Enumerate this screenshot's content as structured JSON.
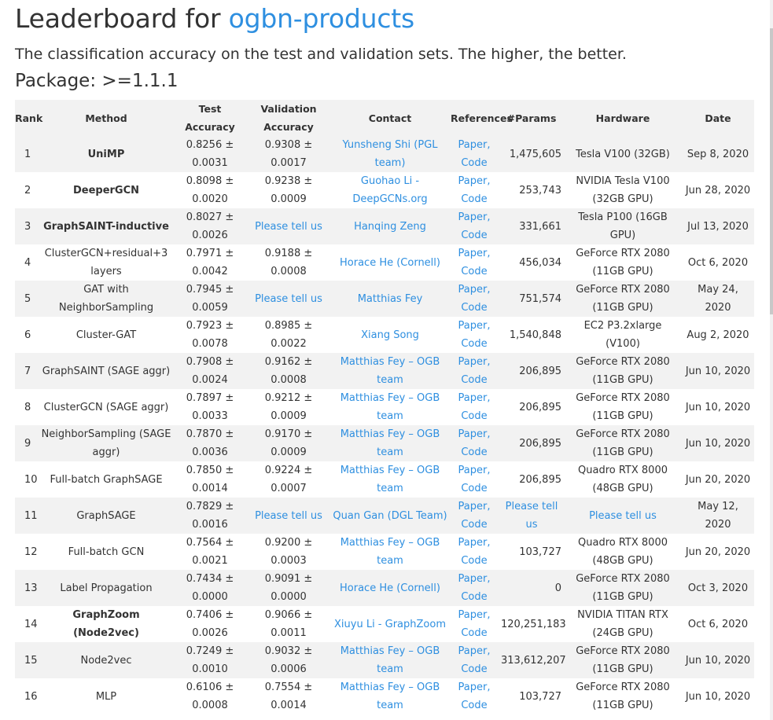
{
  "header": {
    "title_prefix": "Leaderboard for ",
    "title_link": "ogbn-products",
    "description": "The classification accuracy on the test and validation sets. The higher, the better.",
    "package": "Package: >=1.1.1"
  },
  "table": {
    "columns": [
      "Rank",
      "Method",
      "Test Accuracy",
      "Validation Accuracy",
      "Contact",
      "References",
      "#Params",
      "Hardware",
      "Date"
    ],
    "rows": [
      {
        "rank": "1",
        "method": "UniMP",
        "bold": true,
        "test": "0.8256 ± 0.0031",
        "val": "0.9308 ± 0.0017",
        "contact": "Yunsheng Shi (PGL team)",
        "contact_link": true,
        "refs": "Paper, Code",
        "params": "1,475,605",
        "params_link": false,
        "hardware": "Tesla V100 (32GB)",
        "hardware_link": false,
        "date": "Sep 8, 2020"
      },
      {
        "rank": "2",
        "method": "DeeperGCN",
        "bold": true,
        "test": "0.8098 ± 0.0020",
        "val": "0.9238 ± 0.0009",
        "contact": "Guohao Li - DeepGCNs.org",
        "contact_link": true,
        "refs": "Paper, Code",
        "params": "253,743",
        "params_link": false,
        "hardware": "NVIDIA Tesla V100 (32GB GPU)",
        "hardware_link": false,
        "date": "Jun 28, 2020"
      },
      {
        "rank": "3",
        "method": "GraphSAINT-inductive",
        "bold": true,
        "test": "0.8027 ± 0.0026",
        "val": "Please tell us",
        "val_link": true,
        "contact": "Hanqing Zeng",
        "contact_link": true,
        "refs": "Paper, Code",
        "params": "331,661",
        "params_link": false,
        "hardware": "Tesla P100 (16GB GPU)",
        "hardware_link": false,
        "date": "Jul 13, 2020"
      },
      {
        "rank": "4",
        "method": "ClusterGCN+residual+3 layers",
        "bold": false,
        "test": "0.7971 ± 0.0042",
        "val": "0.9188 ± 0.0008",
        "contact": "Horace He (Cornell)",
        "contact_link": true,
        "refs": "Paper, Code",
        "params": "456,034",
        "params_link": false,
        "hardware": "GeForce RTX 2080 (11GB GPU)",
        "hardware_link": false,
        "date": "Oct 6, 2020"
      },
      {
        "rank": "5",
        "method": "GAT with NeighborSampling",
        "bold": false,
        "test": "0.7945 ± 0.0059",
        "val": "Please tell us",
        "val_link": true,
        "contact": "Matthias Fey",
        "contact_link": true,
        "refs": "Paper, Code",
        "params": "751,574",
        "params_link": false,
        "hardware": "GeForce RTX 2080 (11GB GPU)",
        "hardware_link": false,
        "date": "May 24, 2020"
      },
      {
        "rank": "6",
        "method": "Cluster-GAT",
        "bold": false,
        "test": "0.7923 ± 0.0078",
        "val": "0.8985 ± 0.0022",
        "contact": "Xiang Song",
        "contact_link": true,
        "refs": "Paper, Code",
        "params": "1,540,848",
        "params_link": false,
        "hardware": "EC2 P3.2xlarge (V100)",
        "hardware_link": false,
        "date": "Aug 2, 2020"
      },
      {
        "rank": "7",
        "method": "GraphSAINT (SAGE aggr)",
        "bold": false,
        "test": "0.7908 ± 0.0024",
        "val": "0.9162 ± 0.0008",
        "contact": "Matthias Fey – OGB team",
        "contact_link": true,
        "refs": "Paper, Code",
        "params": "206,895",
        "params_link": false,
        "hardware": "GeForce RTX 2080 (11GB GPU)",
        "hardware_link": false,
        "date": "Jun 10, 2020"
      },
      {
        "rank": "8",
        "method": "ClusterGCN (SAGE aggr)",
        "bold": false,
        "test": "0.7897 ± 0.0033",
        "val": "0.9212 ± 0.0009",
        "contact": "Matthias Fey – OGB team",
        "contact_link": true,
        "refs": "Paper, Code",
        "params": "206,895",
        "params_link": false,
        "hardware": "GeForce RTX 2080 (11GB GPU)",
        "hardware_link": false,
        "date": "Jun 10, 2020"
      },
      {
        "rank": "9",
        "method": "NeighborSampling (SAGE aggr)",
        "bold": false,
        "test": "0.7870 ± 0.0036",
        "val": "0.9170 ± 0.0009",
        "contact": "Matthias Fey – OGB team",
        "contact_link": true,
        "refs": "Paper, Code",
        "params": "206,895",
        "params_link": false,
        "hardware": "GeForce RTX 2080 (11GB GPU)",
        "hardware_link": false,
        "date": "Jun 10, 2020"
      },
      {
        "rank": "10",
        "method": "Full-batch GraphSAGE",
        "bold": false,
        "test": "0.7850 ± 0.0014",
        "val": "0.9224 ± 0.0007",
        "contact": "Matthias Fey – OGB team",
        "contact_link": true,
        "refs": "Paper, Code",
        "params": "206,895",
        "params_link": false,
        "hardware": "Quadro RTX 8000 (48GB GPU)",
        "hardware_link": false,
        "date": "Jun 20, 2020"
      },
      {
        "rank": "11",
        "method": "GraphSAGE",
        "bold": false,
        "test": "0.7829 ± 0.0016",
        "val": "Please tell us",
        "val_link": true,
        "contact": "Quan Gan (DGL Team)",
        "contact_link": true,
        "refs": "Paper, Code",
        "params": "Please tell us",
        "params_link": true,
        "hardware": "Please tell us",
        "hardware_link": true,
        "date": "May 12, 2020"
      },
      {
        "rank": "12",
        "method": "Full-batch GCN",
        "bold": false,
        "test": "0.7564 ± 0.0021",
        "val": "0.9200 ± 0.0003",
        "contact": "Matthias Fey – OGB team",
        "contact_link": true,
        "refs": "Paper, Code",
        "params": "103,727",
        "params_link": false,
        "hardware": "Quadro RTX 8000 (48GB GPU)",
        "hardware_link": false,
        "date": "Jun 20, 2020"
      },
      {
        "rank": "13",
        "method": "Label Propagation",
        "bold": false,
        "test": "0.7434 ± 0.0000",
        "val": "0.9091 ± 0.0000",
        "contact": "Horace He (Cornell)",
        "contact_link": true,
        "refs": "Paper, Code",
        "params": "0",
        "params_link": false,
        "hardware": "GeForce RTX 2080 (11GB GPU)",
        "hardware_link": false,
        "date": "Oct 3, 2020"
      },
      {
        "rank": "14",
        "method": "GraphZoom (Node2vec)",
        "bold": true,
        "test": "0.7406 ± 0.0026",
        "val": "0.9066 ± 0.0011",
        "contact": "Xiuyu Li - GraphZoom",
        "contact_link": true,
        "refs": "Paper, Code",
        "params": "120,251,183",
        "params_link": false,
        "hardware": "NVIDIA TITAN RTX (24GB GPU)",
        "hardware_link": false,
        "date": "Oct 6, 2020"
      },
      {
        "rank": "15",
        "method": "Node2vec",
        "bold": false,
        "test": "0.7249 ± 0.0010",
        "val": "0.9032 ± 0.0006",
        "contact": "Matthias Fey – OGB team",
        "contact_link": true,
        "refs": "Paper, Code",
        "params": "313,612,207",
        "params_link": false,
        "hardware": "GeForce RTX 2080 (11GB GPU)",
        "hardware_link": false,
        "date": "Jun 10, 2020"
      },
      {
        "rank": "16",
        "method": "MLP",
        "bold": false,
        "test": "0.6106 ± 0.0008",
        "val": "0.7554 ± 0.0014",
        "contact": "Matthias Fey – OGB team",
        "contact_link": true,
        "refs": "Paper, Code",
        "params": "103,727",
        "params_link": false,
        "hardware": "GeForce RTX 2080 (11GB GPU)",
        "hardware_link": false,
        "date": "Jun 10, 2020"
      }
    ]
  },
  "colors": {
    "link": "#2e8fe0",
    "stripe": "#f2f2f2",
    "text": "#333333"
  }
}
